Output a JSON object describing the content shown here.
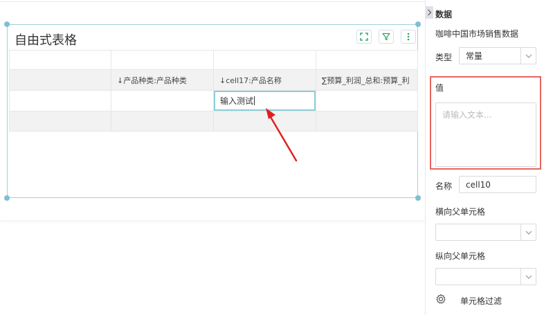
{
  "widget": {
    "title": "自由式表格",
    "tools": [
      "expand-icon",
      "filter-icon",
      "more-vertical-icon"
    ]
  },
  "table": {
    "rows": [
      [
        "",
        "",
        "",
        ""
      ],
      [
        "",
        "↓产品种类:产品种类",
        "↓cell17:产品名称",
        "∑预算_利润_总和:预算_利"
      ],
      [
        "",
        "",
        "",
        ""
      ],
      [
        "",
        "",
        "",
        ""
      ]
    ],
    "editing_value": "输入测试"
  },
  "panel": {
    "section_title": "数据",
    "dataset_name": "咖啡中国市场销售数据",
    "type_label": "类型",
    "type_value": "常量",
    "value_label": "值",
    "value_placeholder": "请输入文本...",
    "name_label": "名称",
    "name_value": "cell10",
    "horizontal_parent_label": "横向父单元格",
    "horizontal_parent_value": "",
    "vertical_parent_label": "纵向父单元格",
    "vertical_parent_value": "",
    "cell_filter_label": "单元格过滤"
  },
  "colors": {
    "accent_green": "#2fa86b",
    "highlight_red": "#e8645f",
    "selection_teal": "#8ccfd8",
    "arrow_red": "#e02020"
  }
}
